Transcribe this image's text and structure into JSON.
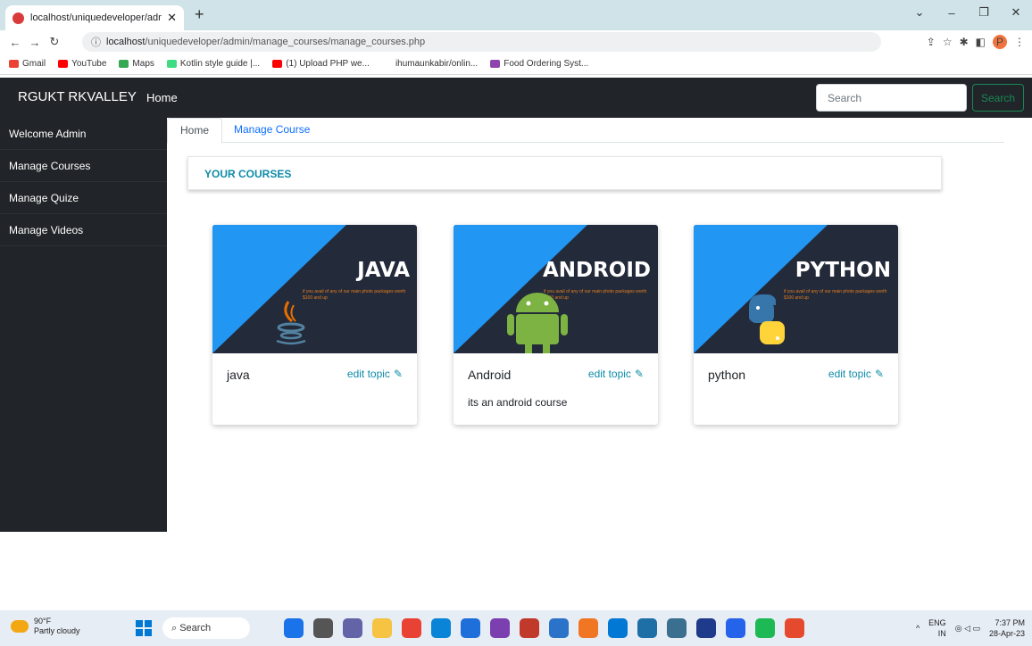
{
  "browser": {
    "tab_title": "localhost/uniquedeveloper/adm",
    "url_host": "localhost",
    "url_path": "/uniquedeveloper/admin/manage_courses/manage_courses.php",
    "bookmarks": [
      "Gmail",
      "YouTube",
      "Maps",
      "Kotlin style guide |...",
      "(1) Upload PHP we...",
      "ihumaunkabir/onlin...",
      "Food Ordering Syst..."
    ]
  },
  "navbar": {
    "brand": "RGUKT RKVALLEY",
    "home": "Home",
    "search_placeholder": "Search",
    "search_button": "Search"
  },
  "sidebar": {
    "items": [
      {
        "label": "Welcome Admin"
      },
      {
        "label": "Manage Courses"
      },
      {
        "label": "Manage Quize"
      },
      {
        "label": "Manage Videos"
      }
    ]
  },
  "breadcrumb": {
    "home": "Home",
    "manage": "Manage Course"
  },
  "heading": "YOUR COURSES",
  "courses": [
    {
      "thumb_title": "JAVA",
      "name": "java",
      "edit": "edit topic",
      "desc": "",
      "promo": "if you avail of any of our main photo packages worth $100 and up"
    },
    {
      "thumb_title": "ANDROID",
      "name": "Android",
      "edit": "edit topic",
      "desc": "its an android course",
      "promo": "if you avail of any of our main photo packages worth $100 and up"
    },
    {
      "thumb_title": "PYTHON",
      "name": "python",
      "edit": "edit topic",
      "desc": "",
      "promo": "if you avail of any of our main photo packages worth $100 and up"
    }
  ],
  "taskbar": {
    "temp": "90°F",
    "weather": "Partly cloudy",
    "search": "Search",
    "lang": "ENG",
    "region": "IN",
    "time": "7:37 PM",
    "date": "28-Apr-23"
  },
  "colors": {
    "navbar": "#212529",
    "accent": "#0e8ba8",
    "thumb_dark": "#232a39",
    "thumb_blue": "#2196f3"
  }
}
